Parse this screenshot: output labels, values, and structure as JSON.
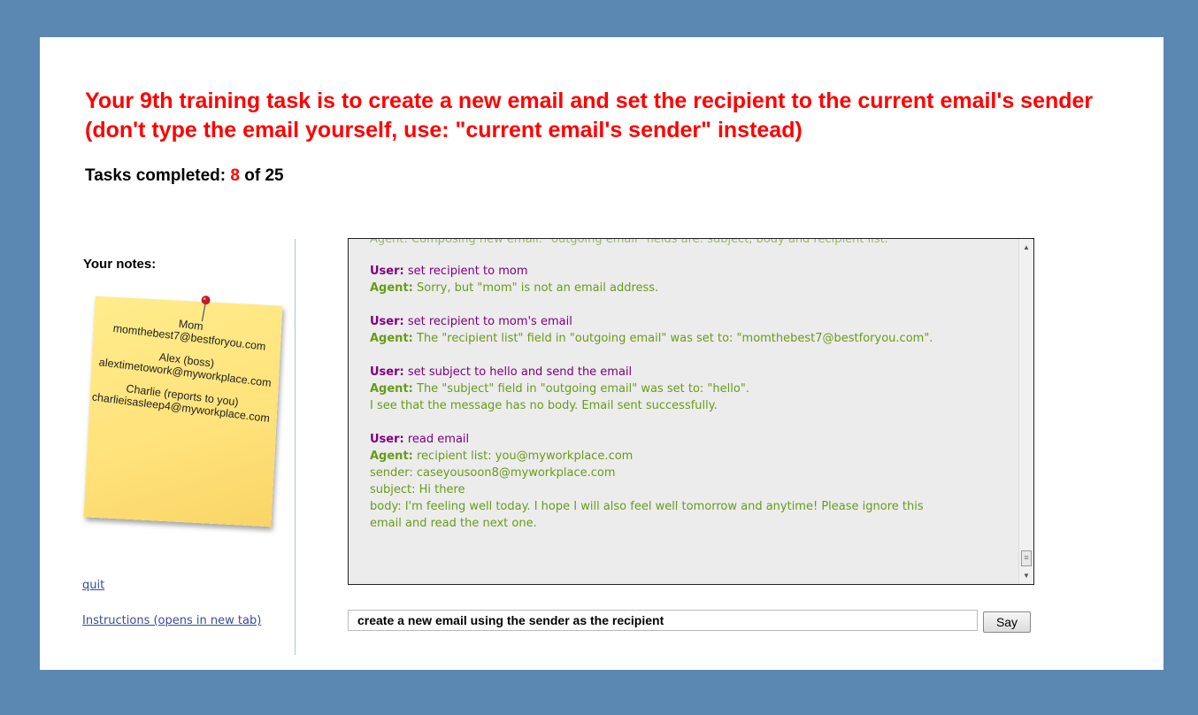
{
  "task": {
    "text": "Your 9th training task is to create a new email and set the recipient to the current email's sender (don't type the email yourself, use: \"current email's sender\" instead)"
  },
  "progress": {
    "label": "Tasks completed:",
    "completed": "8",
    "of_label": "of",
    "total": "25"
  },
  "sidebar": {
    "notes_title": "Your notes:",
    "contacts": [
      {
        "name": "Mom",
        "email": "momthebest7@bestforyou.com"
      },
      {
        "name": "Alex (boss)",
        "email": "alextimetowork@myworkplace.com"
      },
      {
        "name": "Charlie (reports to you)",
        "email": "charlieisasleep4@myworkplace.com"
      }
    ],
    "quit_link": "quit",
    "instructions_link": "Instructions (opens in new tab)"
  },
  "chat": {
    "ghost_line": "Agent: Composing new email. \"outgoing email\" fields are: subject, body and recipient list.",
    "user_label": "User:",
    "agent_label": "Agent:",
    "turns": [
      {
        "user": "set recipient to mom",
        "agent": [
          "Sorry, but \"mom\" is not an email address."
        ]
      },
      {
        "user": "set recipient to mom's email",
        "agent": [
          "The \"recipient list\" field in \"outgoing email\" was set to: \"momthebest7@bestforyou.com\"."
        ]
      },
      {
        "user": "set subject to hello and send the email",
        "agent": [
          "The \"subject\" field in \"outgoing email\" was set to: \"hello\".",
          "I see that the message has no body. Email sent successfully."
        ]
      },
      {
        "user": "read email",
        "agent": [
          "recipient list: you@myworkplace.com",
          "sender: caseyousoon8@myworkplace.com",
          "subject: Hi there",
          "body: I'm feeling well today. I hope I will also feel well tomorrow and anytime! Please ignore this",
          "email and read the next one."
        ]
      }
    ]
  },
  "input": {
    "value": "create a new email using the sender as the recipient"
  },
  "say_button": "Say",
  "icons": {
    "scroll_up": "scroll-up-arrow-icon",
    "scroll_down": "scroll-down-arrow-icon",
    "pin": "push-pin-icon"
  },
  "colors": {
    "background": "#5b87b3",
    "task_text": "#ff0000",
    "user_label": "#800080",
    "agent_text": "#6a9a1a",
    "sticky_note": "#ffe27a"
  }
}
